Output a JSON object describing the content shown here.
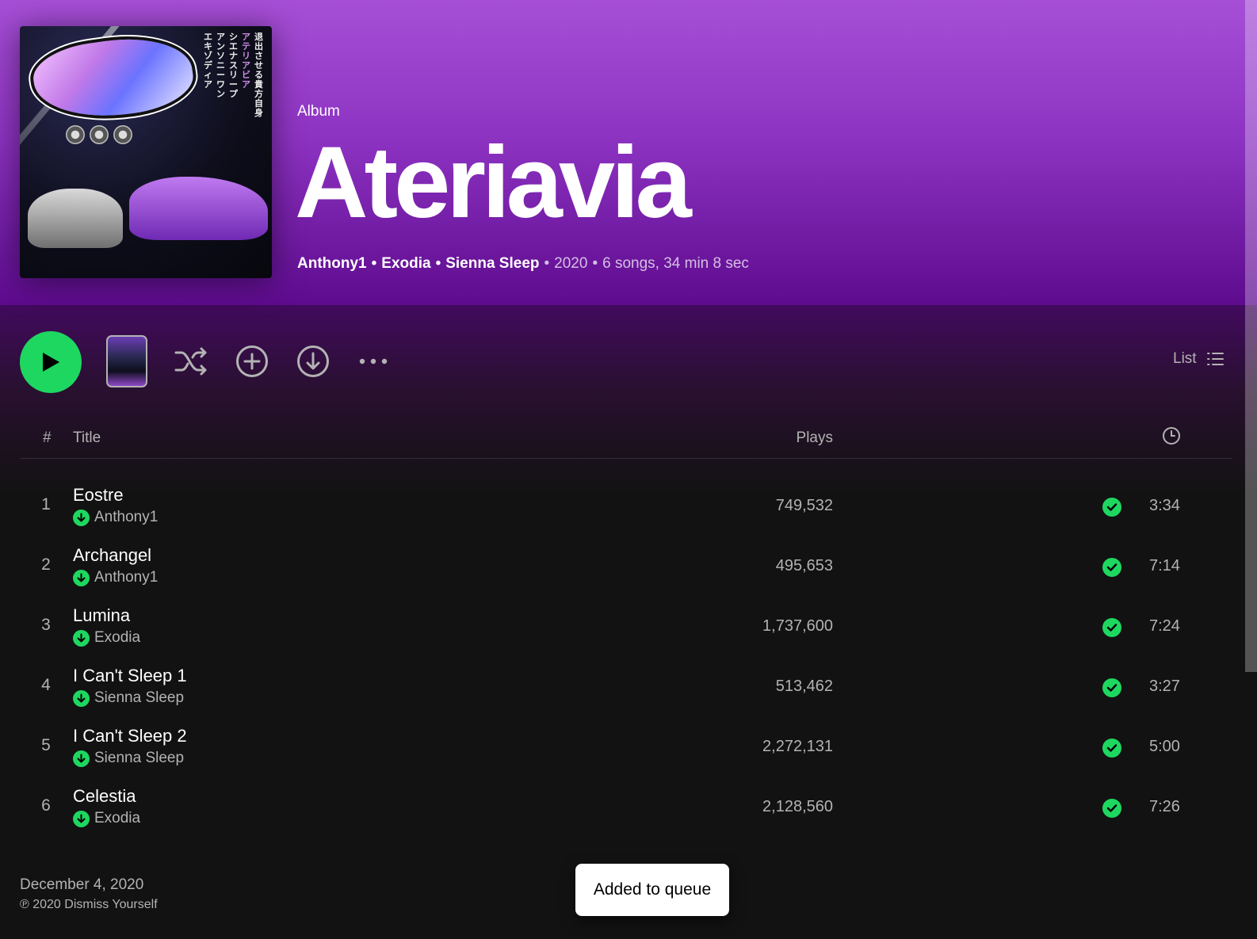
{
  "header": {
    "album_type": "Album",
    "album_title": "Ateriavia",
    "artists": [
      "Anthony1",
      "Exodia",
      "Sienna Sleep"
    ],
    "year": "2020",
    "summary": "6 songs, 34 min 8 sec",
    "cover_text": [
      "退出させる貴方自身",
      "アテリアビア",
      "シエナスリープ",
      "アンソニーワン",
      "エキゾディア"
    ]
  },
  "controls": {
    "play_icon": "play-icon",
    "shuffle_icon": "shuffle-icon",
    "add_icon": "add-to-library-icon",
    "download_icon": "download-icon",
    "more_icon": "more-options-icon",
    "view_label": "List",
    "view_icon": "list-view-icon"
  },
  "table": {
    "headers": {
      "number": "#",
      "title": "Title",
      "plays": "Plays",
      "duration_icon": "clock-icon"
    },
    "tracks": [
      {
        "number": "1",
        "title": "Eostre",
        "artist": "Anthony1",
        "plays": "749,532",
        "duration": "3:34",
        "downloaded": true,
        "saved": true
      },
      {
        "number": "2",
        "title": "Archangel",
        "artist": "Anthony1",
        "plays": "495,653",
        "duration": "7:14",
        "downloaded": true,
        "saved": true
      },
      {
        "number": "3",
        "title": "Lumina",
        "artist": "Exodia",
        "plays": "1,737,600",
        "duration": "7:24",
        "downloaded": true,
        "saved": true
      },
      {
        "number": "4",
        "title": "I Can't Sleep 1",
        "artist": "Sienna Sleep",
        "plays": "513,462",
        "duration": "3:27",
        "downloaded": true,
        "saved": true
      },
      {
        "number": "5",
        "title": "I Can't Sleep 2",
        "artist": "Sienna Sleep",
        "plays": "2,272,131",
        "duration": "5:00",
        "downloaded": true,
        "saved": true
      },
      {
        "number": "6",
        "title": "Celestia",
        "artist": "Exodia",
        "plays": "2,128,560",
        "duration": "7:26",
        "downloaded": true,
        "saved": true
      }
    ]
  },
  "footer": {
    "release_date": "December 4, 2020",
    "copyright": "℗ 2020 Dismiss Yourself"
  },
  "toast": {
    "message": "Added to queue"
  },
  "colors": {
    "accent": "#1ed760",
    "header_top": "#a64fd6",
    "header_bottom": "#5e0b8e",
    "background": "#121212"
  }
}
